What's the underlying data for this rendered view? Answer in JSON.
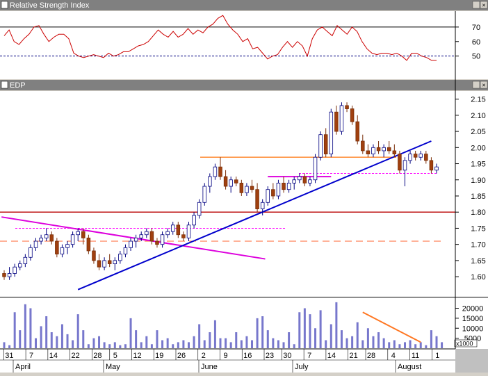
{
  "panels": {
    "rsi": {
      "title": "Relative Strength Index"
    },
    "price": {
      "title": "EDP"
    },
    "volume": {
      "unit_label": "x1000"
    }
  },
  "x_axis": {
    "day_labels": [
      "31",
      "7",
      "14",
      "22",
      "28",
      "5",
      "12",
      "19",
      "26",
      "2",
      "9",
      "16",
      "23",
      "30",
      "7",
      "14",
      "21",
      "28",
      "4",
      "11",
      "1"
    ],
    "month_labels": [
      "April",
      "May",
      "June",
      "July",
      "August"
    ]
  },
  "chart_data": [
    {
      "type": "line",
      "title": "Relative Strength Index",
      "yticks": [
        50,
        60,
        70
      ],
      "ylim": [
        35,
        80
      ],
      "reference_lines": [
        70,
        50
      ],
      "series": [
        {
          "values": [
            64,
            68,
            60,
            58,
            62,
            65,
            70,
            71,
            65,
            60,
            63,
            65,
            65,
            62,
            52,
            50,
            49,
            50,
            51,
            50,
            49,
            52,
            50,
            51,
            53,
            53,
            55,
            57,
            58,
            60,
            64,
            68,
            65,
            63,
            67,
            63,
            65,
            69,
            65,
            68,
            66,
            70,
            72,
            76,
            78,
            72,
            68,
            65,
            60,
            62,
            55,
            56,
            52,
            48,
            50,
            51,
            56,
            60,
            56,
            60,
            57,
            50,
            62,
            68,
            70,
            67,
            64,
            71,
            68,
            65,
            70,
            67,
            60,
            55,
            52,
            51,
            52,
            52,
            51,
            52,
            50,
            47,
            52,
            52,
            50,
            49,
            47,
            47
          ]
        }
      ]
    },
    {
      "type": "candlestick",
      "title": "EDP",
      "yticks": [
        1.6,
        1.65,
        1.7,
        1.75,
        1.8,
        1.85,
        1.9,
        1.95,
        2.0,
        2.05,
        2.1,
        2.15
      ],
      "ylim": [
        1.54,
        2.175
      ],
      "ohlc": [
        [
          1.61,
          1.62,
          1.59,
          1.6
        ],
        [
          1.6,
          1.63,
          1.59,
          1.61
        ],
        [
          1.61,
          1.64,
          1.6,
          1.63
        ],
        [
          1.63,
          1.65,
          1.62,
          1.64
        ],
        [
          1.64,
          1.67,
          1.63,
          1.66
        ],
        [
          1.66,
          1.7,
          1.65,
          1.69
        ],
        [
          1.69,
          1.72,
          1.68,
          1.71
        ],
        [
          1.71,
          1.73,
          1.7,
          1.72
        ],
        [
          1.72,
          1.75,
          1.71,
          1.73
        ],
        [
          1.73,
          1.74,
          1.7,
          1.71
        ],
        [
          1.71,
          1.72,
          1.66,
          1.67
        ],
        [
          1.67,
          1.7,
          1.66,
          1.69
        ],
        [
          1.69,
          1.71,
          1.67,
          1.7
        ],
        [
          1.7,
          1.74,
          1.69,
          1.73
        ],
        [
          1.73,
          1.75,
          1.71,
          1.74
        ],
        [
          1.74,
          1.75,
          1.7,
          1.72
        ],
        [
          1.72,
          1.73,
          1.67,
          1.68
        ],
        [
          1.68,
          1.69,
          1.64,
          1.65
        ],
        [
          1.65,
          1.67,
          1.62,
          1.63
        ],
        [
          1.63,
          1.66,
          1.62,
          1.65
        ],
        [
          1.65,
          1.67,
          1.63,
          1.64
        ],
        [
          1.64,
          1.66,
          1.62,
          1.65
        ],
        [
          1.65,
          1.68,
          1.64,
          1.67
        ],
        [
          1.67,
          1.7,
          1.66,
          1.69
        ],
        [
          1.69,
          1.72,
          1.68,
          1.71
        ],
        [
          1.71,
          1.73,
          1.69,
          1.72
        ],
        [
          1.72,
          1.74,
          1.71,
          1.73
        ],
        [
          1.73,
          1.75,
          1.72,
          1.74
        ],
        [
          1.74,
          1.75,
          1.7,
          1.71
        ],
        [
          1.71,
          1.72,
          1.69,
          1.7
        ],
        [
          1.7,
          1.74,
          1.69,
          1.73
        ],
        [
          1.73,
          1.75,
          1.72,
          1.74
        ],
        [
          1.74,
          1.77,
          1.73,
          1.76
        ],
        [
          1.76,
          1.77,
          1.72,
          1.73
        ],
        [
          1.73,
          1.74,
          1.71,
          1.72
        ],
        [
          1.72,
          1.77,
          1.71,
          1.76
        ],
        [
          1.76,
          1.8,
          1.75,
          1.79
        ],
        [
          1.79,
          1.84,
          1.78,
          1.83
        ],
        [
          1.83,
          1.89,
          1.82,
          1.88
        ],
        [
          1.88,
          1.92,
          1.86,
          1.91
        ],
        [
          1.91,
          1.95,
          1.9,
          1.94
        ],
        [
          1.94,
          1.97,
          1.9,
          1.91
        ],
        [
          1.91,
          1.93,
          1.87,
          1.88
        ],
        [
          1.88,
          1.91,
          1.86,
          1.9
        ],
        [
          1.9,
          1.91,
          1.88,
          1.89
        ],
        [
          1.89,
          1.9,
          1.85,
          1.86
        ],
        [
          1.86,
          1.89,
          1.85,
          1.88
        ],
        [
          1.88,
          1.9,
          1.86,
          1.87
        ],
        [
          1.87,
          1.89,
          1.8,
          1.81
        ],
        [
          1.81,
          1.84,
          1.79,
          1.83
        ],
        [
          1.83,
          1.88,
          1.82,
          1.87
        ],
        [
          1.87,
          1.89,
          1.84,
          1.85
        ],
        [
          1.85,
          1.9,
          1.84,
          1.89
        ],
        [
          1.89,
          1.91,
          1.86,
          1.87
        ],
        [
          1.87,
          1.9,
          1.86,
          1.89
        ],
        [
          1.89,
          1.91,
          1.87,
          1.9
        ],
        [
          1.9,
          1.92,
          1.89,
          1.91
        ],
        [
          1.91,
          1.92,
          1.88,
          1.89
        ],
        [
          1.89,
          1.91,
          1.88,
          1.9
        ],
        [
          1.9,
          1.98,
          1.89,
          1.97
        ],
        [
          1.97,
          2.05,
          1.96,
          2.04
        ],
        [
          2.04,
          2.06,
          1.97,
          1.98
        ],
        [
          1.98,
          2.12,
          1.97,
          2.11
        ],
        [
          2.11,
          2.13,
          2.04,
          2.05
        ],
        [
          2.05,
          2.14,
          2.04,
          2.13
        ],
        [
          2.13,
          2.14,
          2.11,
          2.12
        ],
        [
          2.12,
          2.13,
          2.07,
          2.08
        ],
        [
          2.08,
          2.1,
          2.01,
          2.02
        ],
        [
          2.02,
          2.04,
          1.98,
          1.99
        ],
        [
          1.99,
          2.01,
          1.97,
          1.98
        ],
        [
          1.98,
          2.01,
          1.97,
          2.0
        ],
        [
          2.0,
          2.02,
          1.98,
          1.99
        ],
        [
          1.99,
          2.01,
          1.97,
          2.0
        ],
        [
          2.0,
          2.02,
          1.98,
          1.99
        ],
        [
          1.99,
          2.01,
          1.97,
          1.98
        ],
        [
          1.98,
          1.99,
          1.92,
          1.93
        ],
        [
          1.93,
          1.97,
          1.88,
          1.96
        ],
        [
          1.96,
          1.99,
          1.95,
          1.98
        ],
        [
          1.98,
          1.99,
          1.96,
          1.97
        ],
        [
          1.97,
          1.99,
          1.96,
          1.98
        ],
        [
          1.98,
          1.99,
          1.95,
          1.96
        ],
        [
          1.96,
          1.97,
          1.92,
          1.93
        ],
        [
          1.93,
          1.95,
          1.92,
          1.94
        ]
      ],
      "reference_lines": [
        {
          "value": 1.8,
          "style": "solid",
          "color": "#b80000"
        },
        {
          "value": 1.71,
          "style": "dashed",
          "color": "#ff6633"
        },
        {
          "value": 1.97,
          "style": "solid",
          "color": "#ff8020"
        },
        {
          "value": 1.92,
          "style": "dotted",
          "color": "#ff00ff"
        },
        {
          "value": 1.75,
          "style": "dotted",
          "color": "#ff00ff"
        }
      ],
      "trend_lines": [
        {
          "from": [
            -0.5,
            1.785
          ],
          "to": [
            49.5,
            1.655
          ],
          "color": "#dd00dd"
        },
        {
          "from": [
            14,
            1.56
          ],
          "to": [
            81,
            2.02
          ],
          "color": "#0000cc"
        },
        {
          "from": [
            50,
            1.91
          ],
          "to": [
            62,
            1.91
          ],
          "color": "#dd00dd"
        }
      ]
    },
    {
      "type": "bar",
      "title": "",
      "yticks": [
        5000,
        10000,
        15000,
        20000
      ],
      "ylim": [
        0,
        24000
      ],
      "values": [
        3000,
        1500,
        18000,
        9000,
        22000,
        20000,
        5000,
        11000,
        16000,
        8000,
        6000,
        12000,
        7000,
        4000,
        17000,
        9000,
        2000,
        5000,
        6000,
        3000,
        2000,
        3000,
        1500,
        2000,
        15000,
        9000,
        3000,
        6000,
        2000,
        9000,
        4000,
        5000,
        2000,
        3000,
        4000,
        3000,
        6000,
        12000,
        4000,
        8000,
        14000,
        5000,
        5000,
        3000,
        8000,
        4000,
        6000,
        4000,
        15000,
        16000,
        9000,
        5000,
        4000,
        3000,
        8000,
        2000,
        18000,
        20000,
        17000,
        10000,
        19000,
        4000,
        12000,
        23000,
        9000,
        5000,
        6000,
        13000,
        4000,
        10000,
        6000,
        8000,
        5000,
        3000,
        4000,
        2000,
        3000,
        4000,
        2000,
        3000,
        1500,
        9000,
        6000,
        3000
      ],
      "trend_line": {
        "from": [
          68,
          18000
        ],
        "to": [
          79,
          3000
        ],
        "color": "#ff7722"
      }
    }
  ],
  "colors": {
    "up_fill": "#ffffff",
    "up_edge": "#000080",
    "down_fill": "#a0400f",
    "down_edge": "#7a2e08",
    "rsi_line": "#cc0000",
    "volume_bar": "#7777cc",
    "grid": "#000000"
  }
}
